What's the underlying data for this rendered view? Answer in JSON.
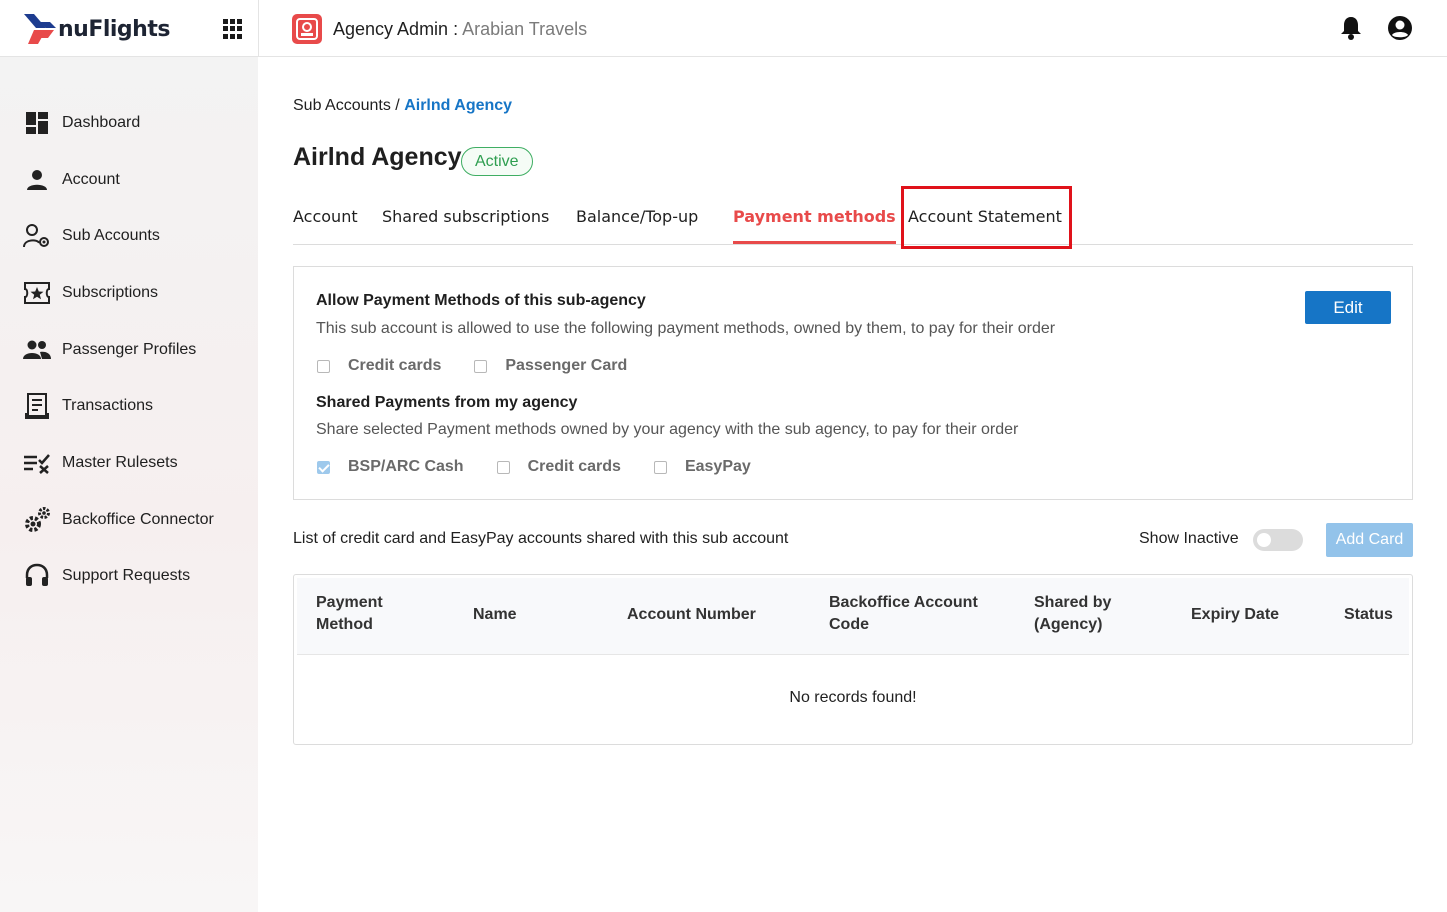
{
  "app": {
    "logo_text": "nuFlights",
    "header": {
      "role": "Agency Admin",
      "separator": " : ",
      "agency_name": "Arabian Travels"
    }
  },
  "sidebar": {
    "items": [
      {
        "label": "Dashboard",
        "icon": "dashboard-icon"
      },
      {
        "label": "Account",
        "icon": "person-icon"
      },
      {
        "label": "Sub Accounts",
        "icon": "sub-accounts-icon"
      },
      {
        "label": "Subscriptions",
        "icon": "ticket-star-icon"
      },
      {
        "label": "Passenger Profiles",
        "icon": "people-icon"
      },
      {
        "label": "Transactions",
        "icon": "receipt-icon"
      },
      {
        "label": "Master Rulesets",
        "icon": "rules-icon"
      },
      {
        "label": "Backoffice Connector",
        "icon": "gears-icon"
      },
      {
        "label": "Support Requests",
        "icon": "headset-icon"
      }
    ]
  },
  "breadcrumb": {
    "parent": "Sub Accounts",
    "separator": " / ",
    "current": "Airlnd Agency"
  },
  "page": {
    "title": "Airlnd Agency",
    "status": "Active"
  },
  "tabs": [
    {
      "label": "Account",
      "active": false
    },
    {
      "label": "Shared subscriptions",
      "active": false
    },
    {
      "label": "Balance/Top-up",
      "active": false
    },
    {
      "label": "Payment methods",
      "active": true
    },
    {
      "label": "Account Statement",
      "active": false
    }
  ],
  "payment_card": {
    "allow_title": "Allow Payment Methods of this sub-agency",
    "allow_desc": "This sub account is allowed to use the following payment methods, owned by them, to pay for their order",
    "allow_options": [
      {
        "label": "Credit cards",
        "checked": false
      },
      {
        "label": "Passenger Card",
        "checked": false
      }
    ],
    "shared_title": "Shared Payments from my agency",
    "shared_desc": "Share selected Payment methods owned by your agency with the sub agency, to pay for their order",
    "shared_options": [
      {
        "label": "BSP/ARC Cash",
        "checked": true
      },
      {
        "label": "Credit cards",
        "checked": false
      },
      {
        "label": "EasyPay",
        "checked": false
      }
    ],
    "edit_label": "Edit"
  },
  "shared_list": {
    "caption": "List of credit card and EasyPay accounts shared with this sub account",
    "show_inactive_label": "Show Inactive",
    "show_inactive_on": false,
    "add_card_label": "Add Card",
    "columns": [
      {
        "line1": "Payment",
        "line2": "Method"
      },
      {
        "line1": "Name",
        "line2": ""
      },
      {
        "line1": "Account Number",
        "line2": ""
      },
      {
        "line1": "Backoffice Account",
        "line2": "Code"
      },
      {
        "line1": "Shared by",
        "line2": "(Agency)"
      },
      {
        "line1": "Expiry Date",
        "line2": ""
      },
      {
        "line1": "Status",
        "line2": ""
      }
    ],
    "empty_message": "No records found!"
  },
  "colors": {
    "primary": "#1675c6",
    "active_tab": "#e84a4a",
    "status_green": "#2e9e50",
    "highlight": "#e0121a"
  }
}
